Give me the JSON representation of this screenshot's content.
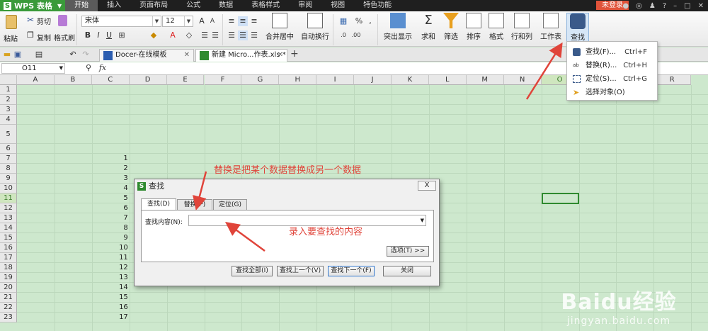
{
  "app": {
    "name": "WPS 表格",
    "logo_letter": "S"
  },
  "menu": [
    "开始",
    "插入",
    "页面布局",
    "公式",
    "数据",
    "表格样式",
    "审阅",
    "视图",
    "特色功能"
  ],
  "login_label": "未登录",
  "ribbon": {
    "paste": "粘贴",
    "cut": "剪切",
    "copy": "复制",
    "format_painter": "格式刷",
    "font_name": "宋体",
    "font_size": "12",
    "merge_center": "合并居中",
    "wrap_text": "自动换行",
    "percent": "%",
    "highlight": "突出显示",
    "sum": "求和",
    "filter": "筛选",
    "sort": "排序",
    "format": "格式",
    "rowcol": "行和列",
    "worksheet": "工作表",
    "find": "查找",
    "bold": "B",
    "italic": "I",
    "underline": "U",
    "sigma": "Σ"
  },
  "find_menu": [
    {
      "label": "查找(F)...",
      "shortcut": "Ctrl+F"
    },
    {
      "label": "替换(R)...",
      "shortcut": "Ctrl+H"
    },
    {
      "label": "定位(S)...",
      "shortcut": "Ctrl+G"
    },
    {
      "label": "选择对象(O)",
      "shortcut": ""
    }
  ],
  "doc_tabs": [
    "Docer-在线模板",
    "新建 Micro...作表.xls *"
  ],
  "name_box": "O11",
  "fx": "fx",
  "columns": [
    "A",
    "B",
    "C",
    "D",
    "E",
    "F",
    "G",
    "H",
    "I",
    "J",
    "K",
    "L",
    "M",
    "N",
    "O",
    "P",
    "Q",
    "R"
  ],
  "rows": [
    "1",
    "2",
    "3",
    "4",
    "5",
    "6",
    "7",
    "8",
    "9",
    "10",
    "11",
    "12",
    "13",
    "14",
    "15",
    "16",
    "17",
    "18",
    "19",
    "20",
    "21",
    "22",
    "23"
  ],
  "cell_values": [
    "1",
    "2",
    "3",
    "4",
    "5",
    "6",
    "7",
    "8",
    "9",
    "10",
    "11",
    "12",
    "13",
    "14",
    "15",
    "16",
    "17"
  ],
  "dialog": {
    "title": "查找",
    "close": "X",
    "tabs": [
      "查找(D)",
      "替换(P)",
      "定位(G)"
    ],
    "label": "查找内容(N):",
    "options": "选项(T) >>",
    "buttons": [
      "查找全部(I)",
      "查找上一个(V)",
      "查找下一个(F)",
      "关闭"
    ]
  },
  "annotations": {
    "replace_note": "替换是把某个数据替换成另一个数据",
    "input_note": "录入要查找的内容"
  },
  "watermark": {
    "brand": "Baidu经验",
    "url": "jingyan.baidu.com"
  },
  "colors": {
    "accent_green": "#2f8a2f",
    "annotation_red": "#e0443a",
    "sheet_bg": "#cde8cd"
  }
}
